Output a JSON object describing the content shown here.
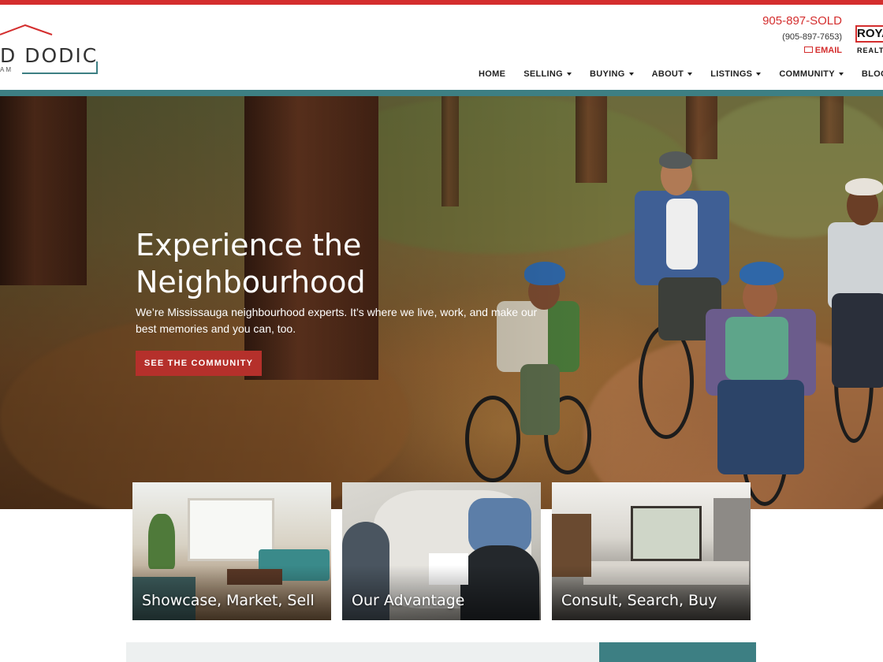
{
  "colors": {
    "accent_red": "#d42e2e",
    "teal": "#3d7f83",
    "button_red": "#b5302b"
  },
  "logo": {
    "name": "D DODIC",
    "sub": "AM"
  },
  "contact": {
    "phone_sold": "905-897-SOLD",
    "phone_number": "(905-897-7653)",
    "email_label": "EMAIL"
  },
  "brand": {
    "line1": "ROYA",
    "line2": "REALT"
  },
  "nav": {
    "items": [
      {
        "label": "HOME",
        "dropdown": false
      },
      {
        "label": "SELLING",
        "dropdown": true
      },
      {
        "label": "BUYING",
        "dropdown": true
      },
      {
        "label": "ABOUT",
        "dropdown": true
      },
      {
        "label": "LISTINGS",
        "dropdown": true
      },
      {
        "label": "COMMUNITY",
        "dropdown": true
      },
      {
        "label": "BLOG",
        "dropdown": false
      }
    ]
  },
  "hero": {
    "title_line1": "Experience the",
    "title_line2": "Neighbourhood",
    "text": "We’re Mississauga neighbourhood experts. It’s where we live, work, and make our best memories and you can, too.",
    "button_label": "SEE THE COMMUNITY"
  },
  "cards": [
    {
      "label": "Showcase, Market, Sell"
    },
    {
      "label": "Our Advantage"
    },
    {
      "label": "Consult, Search, Buy"
    }
  ]
}
